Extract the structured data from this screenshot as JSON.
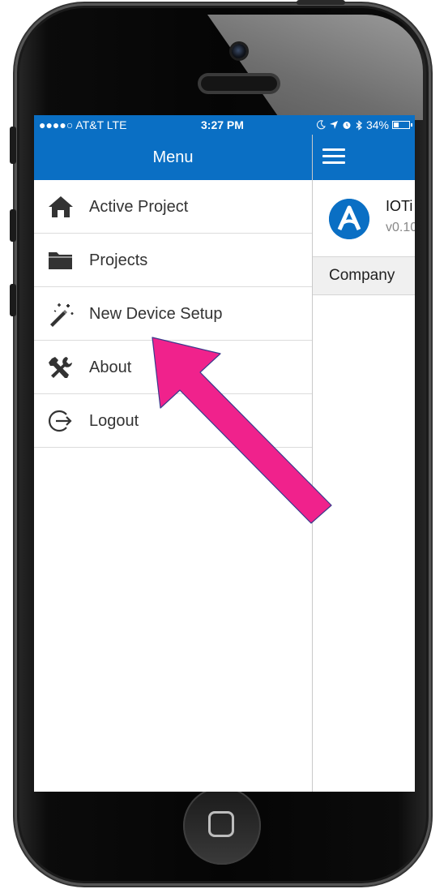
{
  "status_bar": {
    "carrier": "●●●●○ AT&T  LTE",
    "time": "3:27 PM",
    "icons": [
      "moon-icon",
      "location-arrow-icon",
      "alarm-icon",
      "bluetooth-icon"
    ],
    "battery_percent": "34%",
    "battery_level": 0.34
  },
  "menu": {
    "title": "Menu",
    "items": [
      {
        "label": "Active Project",
        "icon": "home-icon"
      },
      {
        "label": "Projects",
        "icon": "folder-icon"
      },
      {
        "label": "New Device Setup",
        "icon": "magic-wand-icon"
      },
      {
        "label": "About",
        "icon": "tools-icon"
      },
      {
        "label": "Logout",
        "icon": "logout-icon"
      }
    ]
  },
  "main": {
    "app_title": "IOTi",
    "app_version": "v0.10",
    "company_label": "Company"
  },
  "colors": {
    "header_blue": "#0a6fc4",
    "annotation_arrow": "#f0228c"
  }
}
